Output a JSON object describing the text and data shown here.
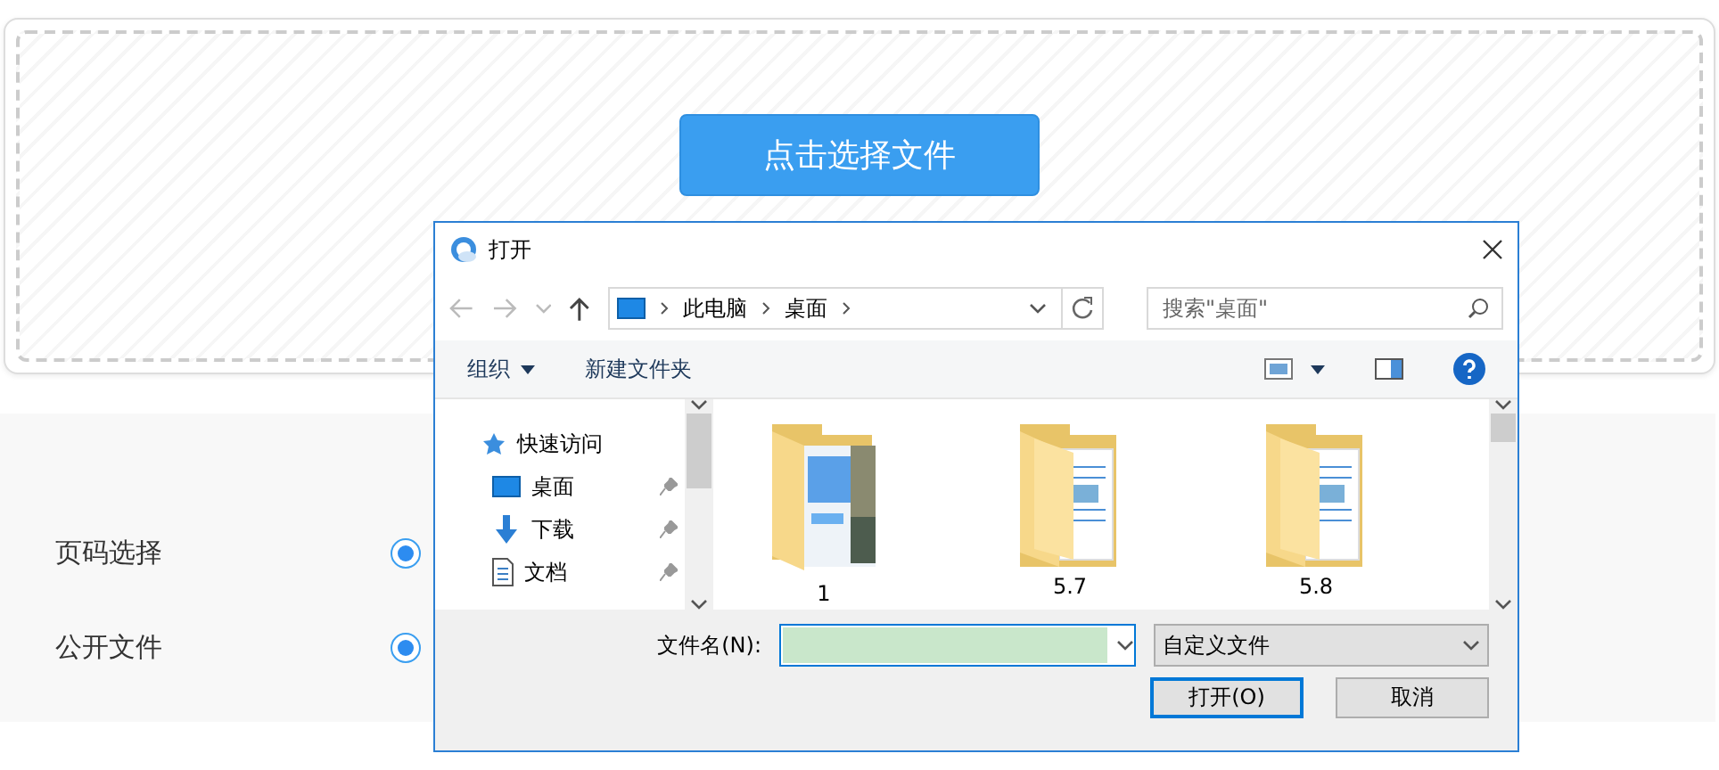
{
  "upload": {
    "button": "点击选择文件"
  },
  "form": {
    "rows": [
      {
        "label": "页码选择",
        "selected": true
      },
      {
        "label": "公开文件",
        "selected": true
      }
    ]
  },
  "dialog": {
    "title": "打开",
    "breadcrumb": [
      "此电脑",
      "桌面"
    ],
    "search": {
      "placeholder": "搜索\"桌面\""
    },
    "toolbar": [
      {
        "label": "组织",
        "dropdown": true
      },
      {
        "label": "新建文件夹",
        "dropdown": false
      }
    ],
    "nav": [
      {
        "label": "快速访问",
        "kind": "quick",
        "pinned": false
      },
      {
        "label": "桌面",
        "kind": "desktop",
        "pinned": true
      },
      {
        "label": "下载",
        "kind": "download",
        "pinned": true
      },
      {
        "label": "文档",
        "kind": "document",
        "pinned": true
      }
    ],
    "files": [
      {
        "name": "1",
        "kind": "photo-folder"
      },
      {
        "name": "5.7",
        "kind": "folder"
      },
      {
        "name": "5.8",
        "kind": "folder"
      }
    ],
    "filename_label": "文件名(N):",
    "filetype": "自定义文件",
    "buttons": [
      {
        "label": "打开(O)",
        "default": true
      },
      {
        "label": "取消",
        "default": false
      }
    ]
  }
}
